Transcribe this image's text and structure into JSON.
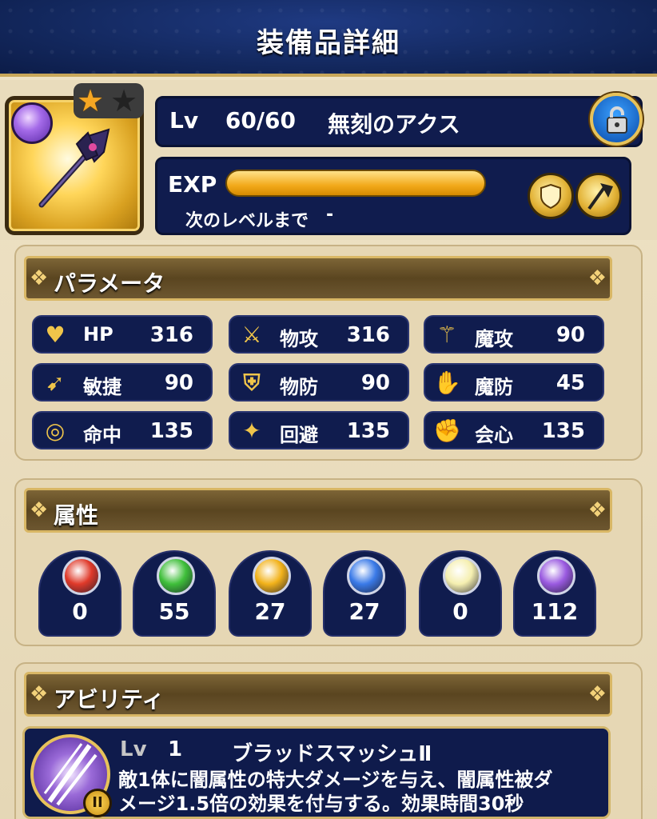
{
  "header": {
    "title": "装備品詳細"
  },
  "item": {
    "level_label": "Lv",
    "level_value": "60/60",
    "name": "無刻のアクス",
    "rarity_stars": 1,
    "rarity_max": 2,
    "exp_label": "EXP",
    "exp_progress": 1.0,
    "next_level_label": "次のレベルまで",
    "next_level_value": "-",
    "element_icon": "dark-element-icon",
    "lock_icon": "lock-icon",
    "role_icons": [
      "shield-swords-icon",
      "axe-icon"
    ]
  },
  "parameters": {
    "title": "パラメータ",
    "stats": [
      {
        "icon": "heart-icon",
        "label": "HP",
        "value": "316"
      },
      {
        "icon": "sword-icon",
        "label": "物攻",
        "value": "316"
      },
      {
        "icon": "magic-staff-icon",
        "label": "魔攻",
        "value": "90"
      },
      {
        "icon": "wing-boot-icon",
        "label": "敏捷",
        "value": "90"
      },
      {
        "icon": "shield-icon",
        "label": "物防",
        "value": "90"
      },
      {
        "icon": "magic-shield-icon",
        "label": "魔防",
        "value": "45"
      },
      {
        "icon": "target-icon",
        "label": "命中",
        "value": "135"
      },
      {
        "icon": "dodge-icon",
        "label": "回避",
        "value": "135"
      },
      {
        "icon": "fist-icon",
        "label": "会心",
        "value": "135"
      }
    ]
  },
  "attributes": {
    "title": "属性",
    "elements": [
      {
        "icon": "fire-element-icon",
        "value": "0",
        "color": "#e03a2a"
      },
      {
        "icon": "wind-element-icon",
        "value": "55",
        "color": "#3fbf3a"
      },
      {
        "icon": "thunder-element-icon",
        "value": "27",
        "color": "#f2b21a"
      },
      {
        "icon": "ice-element-icon",
        "value": "27",
        "color": "#3a7ae8"
      },
      {
        "icon": "light-element-icon",
        "value": "0",
        "color": "#f5efb0"
      },
      {
        "icon": "dark-element-icon",
        "value": "112",
        "color": "#9a5ae0"
      }
    ]
  },
  "ability": {
    "title": "アビリティ",
    "level_label": "Lv",
    "level_value": "1",
    "name": "ブラッドスマッシュⅡ",
    "badge": "II",
    "description_line1": "敵1体に闇属性の特大ダメージを与え、闇属性被ダ",
    "description_line2": "メージ1.5倍の効果を付与する。効果時間30秒"
  },
  "colors": {
    "panel_navy": "#101c4e",
    "gold": "#d9b765",
    "section_bg": "#e6d7b4"
  }
}
